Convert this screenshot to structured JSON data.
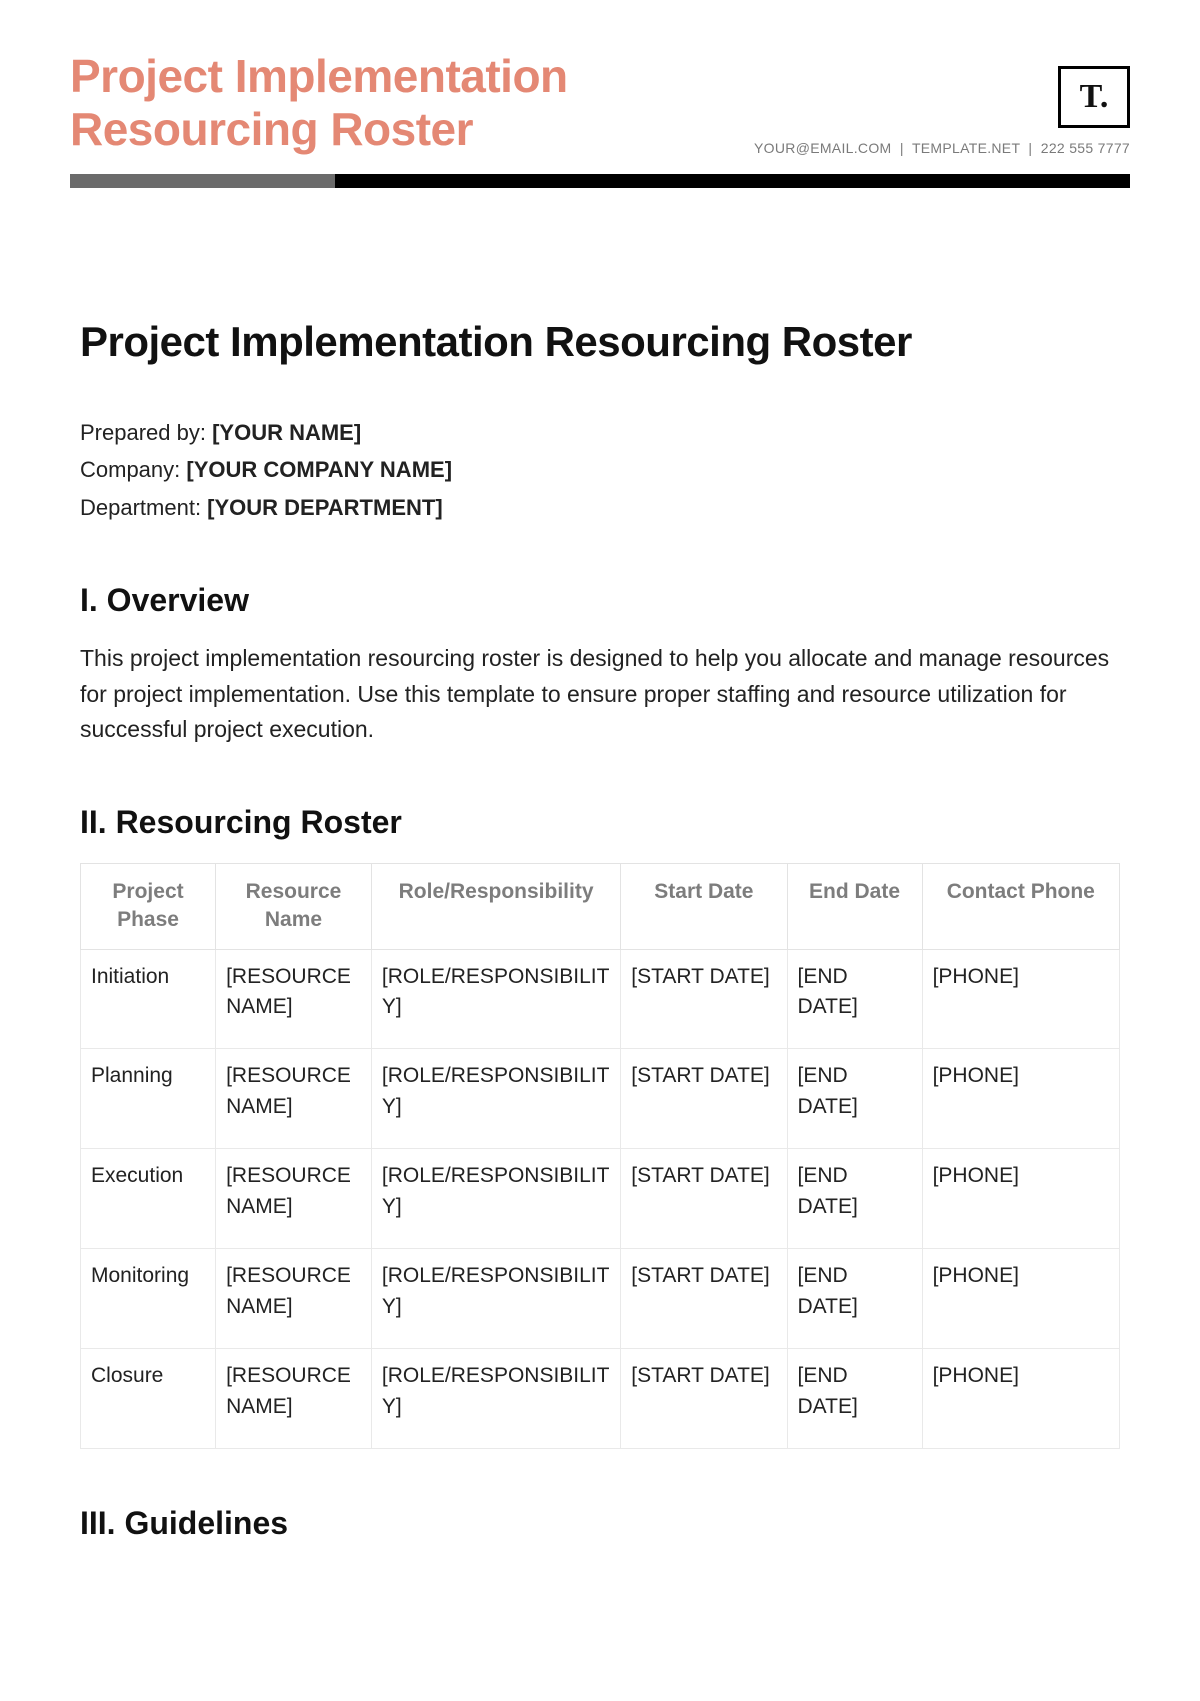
{
  "header": {
    "title_line1": "Project Implementation",
    "title_line2": "Resourcing Roster",
    "logo_text": "T.",
    "contact_email": "YOUR@EMAIL.COM",
    "contact_site": "TEMPLATE.NET",
    "contact_phone": "222 555 7777"
  },
  "main": {
    "heading": "Project Implementation Resourcing Roster",
    "prepared_by_label": "Prepared by: ",
    "prepared_by_value": "[YOUR NAME]",
    "company_label": "Company: ",
    "company_value": "[YOUR COMPANY NAME]",
    "department_label": "Department: ",
    "department_value": "[YOUR DEPARTMENT]"
  },
  "sections": {
    "overview_heading": "I. Overview",
    "overview_body": "This project implementation resourcing roster is designed to help you allocate and manage resources for project implementation. Use this template to ensure proper staffing and resource utilization for successful project execution.",
    "roster_heading": "II. Resourcing Roster",
    "guidelines_heading": "III. Guidelines"
  },
  "table": {
    "headers": {
      "phase": "Project Phase",
      "name": "Resource Name",
      "role": "Role/Responsibility",
      "start": "Start Date",
      "end": "End Date",
      "phone": "Contact Phone"
    },
    "rows": [
      {
        "phase": "Initiation",
        "name": "[RESOURCE NAME]",
        "role": "[ROLE/RESPONSIBILITY]",
        "start": "[START DATE]",
        "end": "[END DATE]",
        "phone": "[PHONE]"
      },
      {
        "phase": "Planning",
        "name": "[RESOURCE NAME]",
        "role": "[ROLE/RESPONSIBILITY]",
        "start": "[START DATE]",
        "end": "[END DATE]",
        "phone": "[PHONE]"
      },
      {
        "phase": "Execution",
        "name": "[RESOURCE NAME]",
        "role": "[ROLE/RESPONSIBILITY]",
        "start": "[START DATE]",
        "end": "[END DATE]",
        "phone": "[PHONE]"
      },
      {
        "phase": "Monitoring",
        "name": "[RESOURCE NAME]",
        "role": "[ROLE/RESPONSIBILITY]",
        "start": "[START DATE]",
        "end": "[END DATE]",
        "phone": "[PHONE]"
      },
      {
        "phase": "Closure",
        "name": "[RESOURCE NAME]",
        "role": "[ROLE/RESPONSIBILITY]",
        "start": "[START DATE]",
        "end": "[END DATE]",
        "phone": "[PHONE]"
      }
    ]
  }
}
